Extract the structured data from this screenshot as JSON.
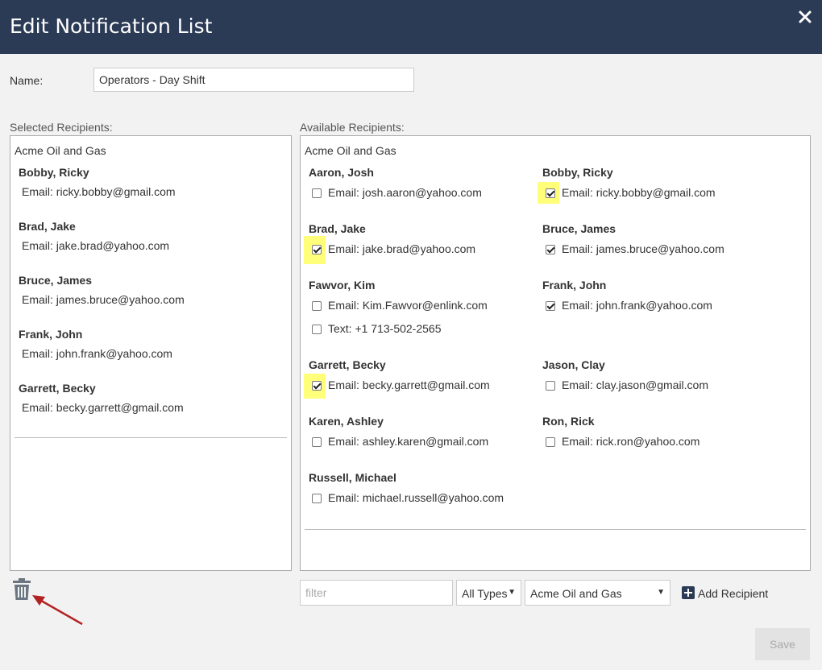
{
  "modal": {
    "title": "Edit Notification List"
  },
  "name_field": {
    "label": "Name:",
    "value": "Operators - Day Shift"
  },
  "selected": {
    "label": "Selected Recipients:",
    "org": "Acme Oil and Gas",
    "people": [
      {
        "name": "Bobby, Ricky",
        "email": "Email: ricky.bobby@gmail.com"
      },
      {
        "name": "Brad, Jake",
        "email": "Email: jake.brad@yahoo.com"
      },
      {
        "name": "Bruce, James",
        "email": "Email: james.bruce@yahoo.com"
      },
      {
        "name": "Frank, John",
        "email": "Email: john.frank@yahoo.com"
      },
      {
        "name": "Garrett, Becky",
        "email": "Email: becky.garrett@gmail.com"
      }
    ]
  },
  "available": {
    "label": "Available Recipients:",
    "org": "Acme Oil and Gas",
    "people": [
      {
        "name": "Aaron, Josh",
        "contacts": [
          {
            "text": "Email: josh.aaron@yahoo.com",
            "checked": false,
            "highlight": false
          }
        ]
      },
      {
        "name": "Bobby, Ricky",
        "contacts": [
          {
            "text": "Email: ricky.bobby@gmail.com",
            "checked": true,
            "highlight": true
          }
        ]
      },
      {
        "name": "Brad, Jake",
        "contacts": [
          {
            "text": "Email: jake.brad@yahoo.com",
            "checked": true,
            "highlight": true
          }
        ]
      },
      {
        "name": "Bruce, James",
        "contacts": [
          {
            "text": "Email: james.bruce@yahoo.com",
            "checked": true,
            "highlight": false
          }
        ]
      },
      {
        "name": "Fawvor, Kim",
        "contacts": [
          {
            "text": "Email: Kim.Fawvor@enlink.com",
            "checked": false,
            "highlight": false
          },
          {
            "text": "Text: +1 713-502-2565",
            "checked": false,
            "highlight": false
          }
        ]
      },
      {
        "name": "Frank, John",
        "contacts": [
          {
            "text": "Email: john.frank@yahoo.com",
            "checked": true,
            "highlight": false
          }
        ]
      },
      {
        "name": "Garrett, Becky",
        "contacts": [
          {
            "text": "Email: becky.garrett@gmail.com",
            "checked": true,
            "highlight": true
          }
        ]
      },
      {
        "name": "Jason, Clay",
        "contacts": [
          {
            "text": "Email: clay.jason@gmail.com",
            "checked": false,
            "highlight": false
          }
        ]
      },
      {
        "name": "Karen, Ashley",
        "contacts": [
          {
            "text": "Email: ashley.karen@gmail.com",
            "checked": false,
            "highlight": false
          }
        ]
      },
      {
        "name": "Ron, Rick",
        "contacts": [
          {
            "text": "Email: rick.ron@yahoo.com",
            "checked": false,
            "highlight": false
          }
        ]
      },
      {
        "name": "Russell, Michael",
        "contacts": [
          {
            "text": "Email: michael.russell@yahoo.com",
            "checked": false,
            "highlight": false
          }
        ]
      }
    ]
  },
  "toolbar": {
    "filter_placeholder": "filter",
    "type_select": "All Types",
    "org_select": "Acme Oil and Gas",
    "add_label": "Add Recipient"
  },
  "footer": {
    "save_label": "Save"
  },
  "icons": {
    "close": "close-icon",
    "delete": "trash-icon",
    "add": "plus-square-icon",
    "annotation": "red-arrow-icon"
  },
  "colors": {
    "header_bg": "#2b3a55",
    "highlight": "#ffff7a",
    "arrow": "#b22222"
  }
}
